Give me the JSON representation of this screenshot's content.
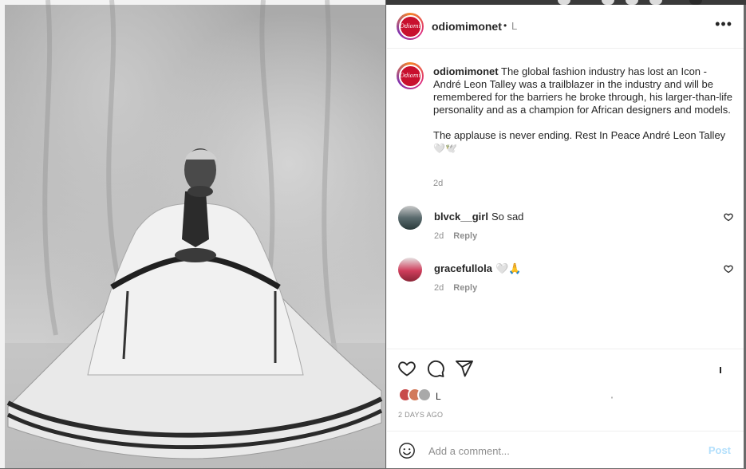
{
  "post": {
    "image_alt": "Black and white portrait of André Leon Talley seated in a voluminous white robe",
    "header": {
      "username": "odiomimonet",
      "separator": "•",
      "follow_label": "L",
      "more_icon": "more-horizontal-icon"
    },
    "avatar_text": "Odiomi",
    "caption": {
      "username": "odiomimonet",
      "paragraph1": "The global fashion industry has lost an Icon - André Leon Talley was a trailblazer in the industry and will be remembered for the barriers he broke through, his larger-than-life personality and as a champion for African designers and models.",
      "paragraph2": "The applause is never ending. Rest In Peace André Leon Talley",
      "emojis": "🤍🕊️",
      "time": "2d"
    },
    "comments": [
      {
        "username": "blvck__girl",
        "text": "So sad",
        "time": "2d",
        "reply_label": "Reply"
      },
      {
        "username": "gracefullola",
        "text": "🤍🙏",
        "time": "2d",
        "reply_label": "Reply"
      }
    ],
    "actions": {
      "like_icon": "heart-icon",
      "comment_icon": "comment-icon",
      "share_icon": "send-icon",
      "save_icon": "bookmark-icon"
    },
    "likes": {
      "text": "L",
      "tail": "ˌ"
    },
    "timestamp": "2 DAYS AGO",
    "add_comment": {
      "placeholder": "Add a comment...",
      "post_label": "Post",
      "emoji_icon": "smiley-icon"
    }
  },
  "colors": {
    "avatar_ring": "#dd2a7b",
    "avatar_fill": "#c8102e",
    "muted_text": "#8e8e8e",
    "post_button_disabled": "#b2dffc"
  }
}
